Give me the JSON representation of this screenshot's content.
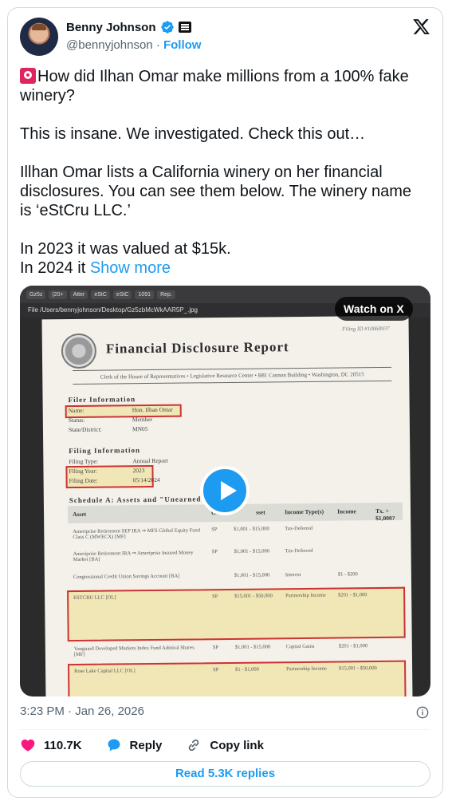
{
  "author": {
    "name": "Benny Johnson",
    "handle": "@bennyjohnson",
    "separator": "·",
    "follow_label": "Follow"
  },
  "tweet": {
    "line1": "How did Ilhan Omar make millions from a 100% fake winery?",
    "line2": "This is insane. We investigated. Check this out…",
    "line3": "Illhan Omar lists a California winery on her financial disclosures. You can see them below. The winery name is ‘eStCru LLC.’",
    "line4": "In 2023 it was valued at $15k.",
    "line5_prefix": "In 2024 it ",
    "show_more": "Show more"
  },
  "media": {
    "watch_label": "Watch on X",
    "browser_tabs": [
      "Gz5z",
      "(20+",
      "Atter",
      "eStC",
      "eStC",
      "1091",
      "Rep."
    ],
    "address": "/Users/bennyjohnson/Desktop/Gz5zbMcWkAAR5P_.jpg",
    "address_prefix": "File",
    "document": {
      "file_id": "Filing ID #10060937",
      "title": "Financial Disclosure Report",
      "clerk_line": "Clerk of the House of Representatives • Legislative Resource Center • B81 Cannon Building • Washington, DC 20515",
      "filer_heading": "Filer Information",
      "filer": [
        {
          "k": "Name:",
          "v": "Hon. Ilhan Omar"
        },
        {
          "k": "Status:",
          "v": "Member"
        },
        {
          "k": "State/District:",
          "v": "MN05"
        }
      ],
      "filing_heading": "Filing Information",
      "filing": [
        {
          "k": "Filing Type:",
          "v": "Annual Report"
        },
        {
          "k": "Filing Year:",
          "v": "2023"
        },
        {
          "k": "Filing Date:",
          "v": "05/14/2024"
        }
      ],
      "schedule_heading": "Schedule A: Assets and \"Unearned\" I",
      "columns": {
        "asset": "Asset",
        "owner": "Owner",
        "value": "sset",
        "income_type": "Income Type(s)",
        "income": "Income",
        "tx": "Tx. > $1,000?"
      },
      "rows": [
        {
          "asset": "Ameriprise Retirement SEP IRA ⇒ MFS Global Equity Fund Class C (MWECX) [MF]",
          "owner": "SP",
          "value": "$1,001 - $15,000",
          "type": "Tax-Deferred",
          "income": ""
        },
        {
          "asset": "Ameriprise Retirement IRA ⇒ Ameriprise Insured Money Market [BA]",
          "owner": "SP",
          "value": "$1,001 - $15,000",
          "type": "Tax-Deferred",
          "income": ""
        },
        {
          "asset": "Congressional Credit Union Savings Account [BA]",
          "owner": "",
          "value": "$1,001 - $15,000",
          "type": "Interest",
          "income": "$1 - $200"
        },
        {
          "asset": "ESTCRU LLC [OL]",
          "owner": "SP",
          "value": "$15,001 - $50,000",
          "type": "Partnership Income",
          "income": "$201 - $1,000"
        },
        {
          "asset": "Vanguard Developed Markets Index Fund Admiral Shares [MF]",
          "owner": "SP",
          "value": "$1,001 - $15,000",
          "type": "Capital Gains",
          "income": "$201 - $1,000"
        },
        {
          "asset": "Rose Lake Capital LLC [OL]",
          "owner": "SP",
          "value": "$1 - $1,000",
          "type": "Partnership Income",
          "income": "$15,001 - $50,000"
        }
      ]
    }
  },
  "meta": {
    "timestamp": "3:23 PM · Jan 26, 2026"
  },
  "actions": {
    "likes": "110.7K",
    "reply_label": "Reply",
    "copy_link_label": "Copy link"
  },
  "read_replies": "Read 5.3K replies",
  "colors": {
    "accent": "#1d9bf0",
    "like": "#f91880",
    "text": "#0f1419",
    "muted": "#536471"
  }
}
